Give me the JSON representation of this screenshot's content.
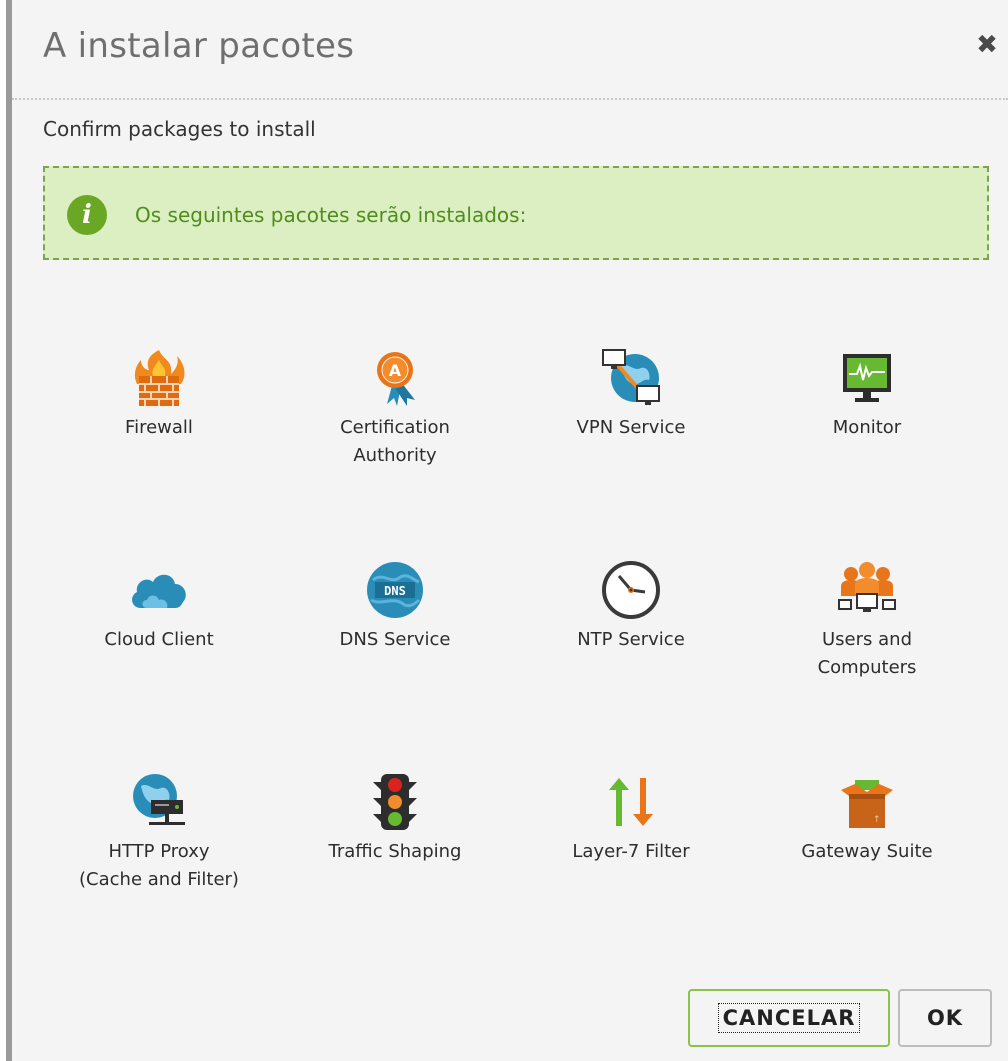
{
  "dialog": {
    "title": "A instalar pacotes",
    "subtitle": "Confirm packages to install",
    "info_message": "Os seguintes pacotes serão instalados:",
    "info_icon": "i"
  },
  "packages": [
    {
      "label_lines": [
        "Firewall"
      ],
      "icon": "firewall-icon"
    },
    {
      "label_lines": [
        "Certification",
        "Authority"
      ],
      "icon": "certificate-icon"
    },
    {
      "label_lines": [
        "VPN Service"
      ],
      "icon": "vpn-icon"
    },
    {
      "label_lines": [
        "Monitor"
      ],
      "icon": "monitor-icon"
    },
    {
      "label_lines": [
        "Cloud Client"
      ],
      "icon": "cloud-icon"
    },
    {
      "label_lines": [
        "DNS Service"
      ],
      "icon": "dns-icon",
      "icon_text": "DNS"
    },
    {
      "label_lines": [
        "NTP Service"
      ],
      "icon": "clock-icon"
    },
    {
      "label_lines": [
        "Users and",
        "Computers"
      ],
      "icon": "users-icon"
    },
    {
      "label_lines": [
        "HTTP Proxy",
        "(Cache and Filter)"
      ],
      "icon": "proxy-icon"
    },
    {
      "label_lines": [
        "Traffic Shaping"
      ],
      "icon": "traffic-light-icon"
    },
    {
      "label_lines": [
        "Layer-7 Filter"
      ],
      "icon": "layer7-icon"
    },
    {
      "label_lines": [
        "Gateway Suite"
      ],
      "icon": "package-box-icon"
    }
  ],
  "buttons": {
    "cancel": "CANCELAR",
    "ok": "OK"
  },
  "colors": {
    "info_bg": "#dcefc3",
    "info_border": "#7ca44e",
    "info_text": "#4f8e1b",
    "accent_green": "#8bc34a",
    "orange": "#e8751a",
    "teal": "#2a8db8"
  }
}
